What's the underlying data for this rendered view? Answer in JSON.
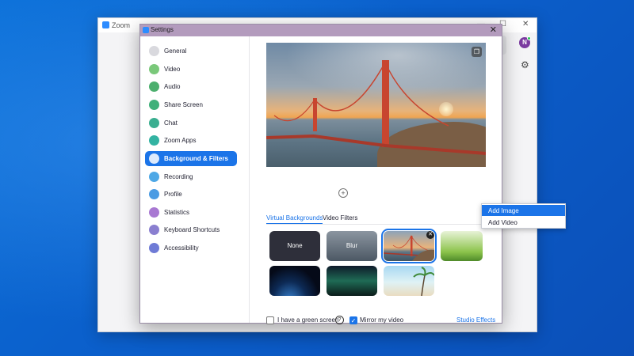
{
  "main_window": {
    "title": "Zoom",
    "controls": [
      "—",
      "☐",
      "✕"
    ],
    "avatar_letter": "N"
  },
  "settings": {
    "title": "Settings",
    "close": "✕",
    "nav": [
      {
        "label": "General",
        "icon": "gear-icon",
        "color": "#d9d9de"
      },
      {
        "label": "Video",
        "icon": "video-icon",
        "color": "#7ac87a"
      },
      {
        "label": "Audio",
        "icon": "headphones-icon",
        "color": "#4caf6e"
      },
      {
        "label": "Share Screen",
        "icon": "share-screen-icon",
        "color": "#3fb07a"
      },
      {
        "label": "Chat",
        "icon": "chat-icon",
        "color": "#3aae90"
      },
      {
        "label": "Zoom Apps",
        "icon": "apps-icon",
        "color": "#33b3a2"
      },
      {
        "label": "Background & Filters",
        "icon": "background-icon",
        "color": "#ffffff"
      },
      {
        "label": "Recording",
        "icon": "recording-icon",
        "color": "#4ea8e6"
      },
      {
        "label": "Profile",
        "icon": "profile-icon",
        "color": "#4b9be3"
      },
      {
        "label": "Statistics",
        "icon": "statistics-icon",
        "color": "#a878d2"
      },
      {
        "label": "Keyboard Shortcuts",
        "icon": "keyboard-icon",
        "color": "#8a7fd0"
      },
      {
        "label": "Accessibility",
        "icon": "accessibility-icon",
        "color": "#6f7bd6"
      }
    ],
    "active_nav": "Background & Filters",
    "tabs": [
      "Virtual Backgrounds",
      "Video Filters"
    ],
    "active_tab": "Virtual Backgrounds",
    "backgrounds": [
      {
        "label": "None",
        "kind": "none"
      },
      {
        "label": "Blur",
        "kind": "blur"
      },
      {
        "label": "",
        "kind": "golden-gate",
        "selected": true
      },
      {
        "label": "",
        "kind": "grass"
      },
      {
        "label": "",
        "kind": "earth"
      },
      {
        "label": "",
        "kind": "aurora"
      },
      {
        "label": "",
        "kind": "beach"
      }
    ],
    "green_screen_label": "I have a green screen",
    "green_screen_checked": false,
    "mirror_label": "Mirror my video",
    "mirror_checked": true,
    "studio_effects": "Studio Effects",
    "add_menu": [
      "Add Image",
      "Add Video"
    ],
    "add_menu_highlight": "Add Image"
  }
}
